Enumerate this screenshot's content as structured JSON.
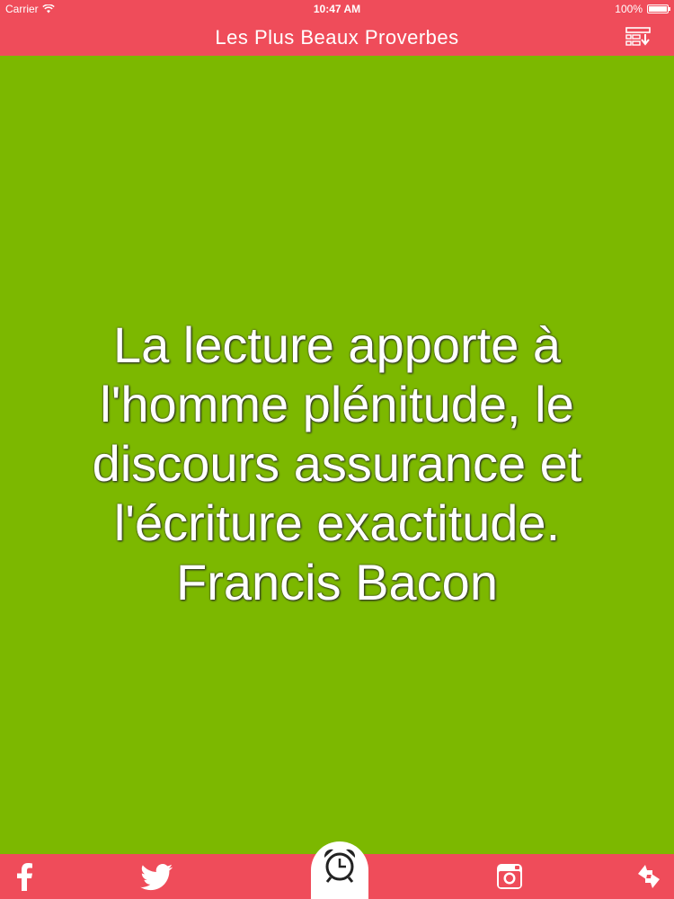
{
  "status_bar": {
    "carrier": "Carrier",
    "time": "10:47 AM",
    "battery": "100%"
  },
  "nav": {
    "title": "Les Plus Beaux Proverbes",
    "menu_icon": "list-download-icon"
  },
  "quote": {
    "text": "La lecture apporte à l'homme plénitude, le discours assurance et l'écriture exactitude. Francis Bacon"
  },
  "tab_bar": {
    "items": [
      "facebook-icon",
      "twitter-icon",
      "alarm-clock-icon",
      "instagram-icon",
      "refresh-icon"
    ]
  },
  "colors": {
    "bar_background": "#ef4c5a",
    "page_background": "#7cb800",
    "text": "#ffffff"
  }
}
